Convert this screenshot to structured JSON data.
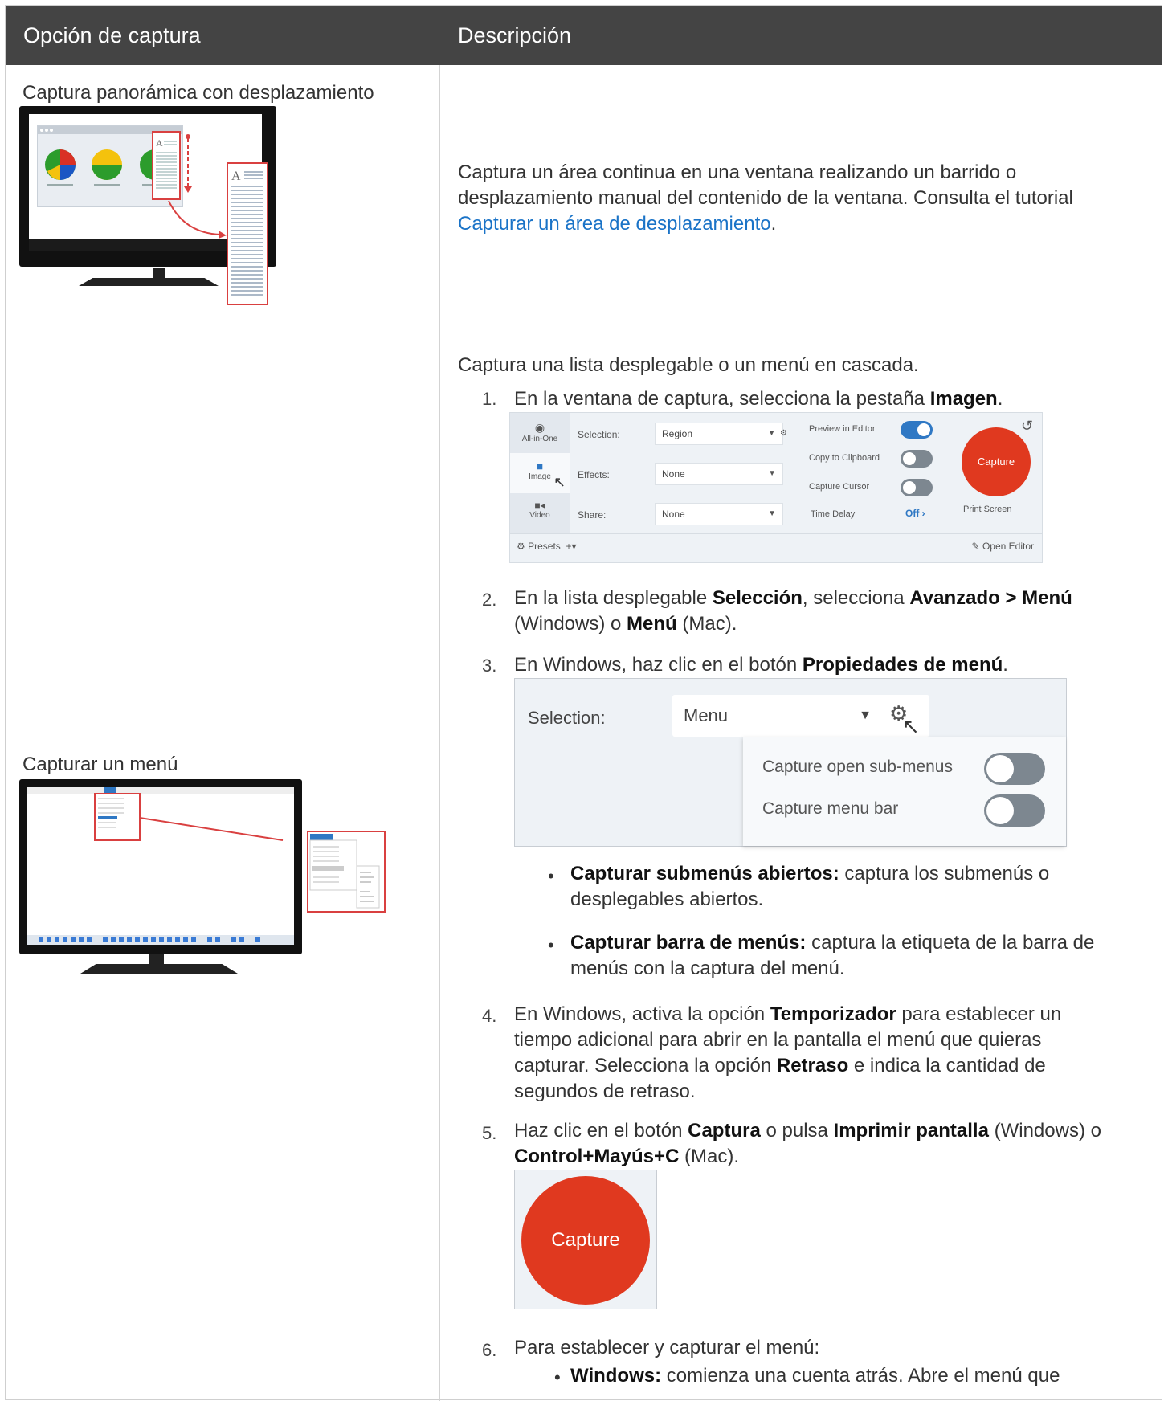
{
  "header": {
    "col1": "Opción de captura",
    "col2": "Descripción"
  },
  "row1": {
    "title": "Captura panorámica con desplazamiento",
    "desc_line1": "Captura un área continua en una ventana realizando un barrido o",
    "desc_line2": "desplazamiento manual del contenido de la ventana. Consulta el tutorial",
    "link": "Capturar un área de desplazamiento",
    "link_after": "."
  },
  "row2": {
    "title": "Capturar un menú",
    "intro": "Captura una lista desplegable o un menú en cascada.",
    "steps": {
      "s1": {
        "num": "1.",
        "a": "En la ventana de captura, selecciona la pestaña ",
        "b": "Imagen",
        "c": "."
      },
      "s2": {
        "num": "2.",
        "a": "En la lista desplegable ",
        "b": "Selección",
        "c": ", selecciona ",
        "d": "Avanzado > Menú",
        "e": "(Windows) o ",
        "f": "Menú",
        "g": " (Mac)."
      },
      "s3": {
        "num": "3.",
        "a": "En Windows, haz clic en el botón ",
        "b": "Propiedades de menú",
        "c": "."
      },
      "bullets": [
        {
          "b": "Capturar submenús abiertos:",
          "a": " captura los submenús o",
          "line2": "desplegables abiertos."
        },
        {
          "b": "Capturar barra de menús:",
          "a": " captura la etiqueta de la barra de",
          "line2": "menús con la captura del menú."
        }
      ],
      "s4": {
        "num": "4.",
        "a": "En Windows, activa la opción ",
        "b": "Temporizador",
        "c": " para establecer un",
        "line2": "tiempo adicional para abrir en la pantalla el menú que quieras",
        "line3a": "capturar. Selecciona la opción ",
        "line3b": "Retraso",
        "line3c": " e indica la cantidad de",
        "line4": "segundos de retraso."
      },
      "s5": {
        "num": "5.",
        "a": "Haz clic en el botón ",
        "b": "Captura",
        "c": " o pulsa ",
        "d": "Imprimir pantalla",
        "e": " (Windows) o",
        "f": "Control+Mayús+C",
        "g": " (Mac)."
      },
      "s6": {
        "num": "6.",
        "a": "Para establecer y capturar el menú:",
        "bullet_b": "Windows:",
        "bullet_a": " comienza una cuenta atrás. Abre el menú que"
      }
    }
  },
  "panel1": {
    "tabs": [
      "All-in-One",
      "Image",
      "Video"
    ],
    "labels": {
      "selection": "Selection:",
      "effects": "Effects:",
      "share": "Share:"
    },
    "dropdowns": {
      "selection": "Region",
      "effects": "None",
      "share": "None"
    },
    "toggles": [
      {
        "label": "Preview in Editor",
        "on": true
      },
      {
        "label": "Copy to Clipboard",
        "on": false
      },
      {
        "label": "Capture Cursor",
        "on": false
      }
    ],
    "time_delay": "Time Delay",
    "time_delay_value": "Off",
    "capture": "Capture",
    "print_screen": "Print Screen",
    "presets": "Presets",
    "open_editor": "Open Editor"
  },
  "panel2": {
    "selection_label": "Selection:",
    "selection_value": "Menu",
    "options": [
      "Capture open sub-menus",
      "Capture menu bar"
    ]
  },
  "capture_button": "Capture",
  "colors": {
    "header_bg": "#444444",
    "capture_red": "#e0391f",
    "toggle_on": "#2f78c4",
    "link": "#1a73c7"
  }
}
